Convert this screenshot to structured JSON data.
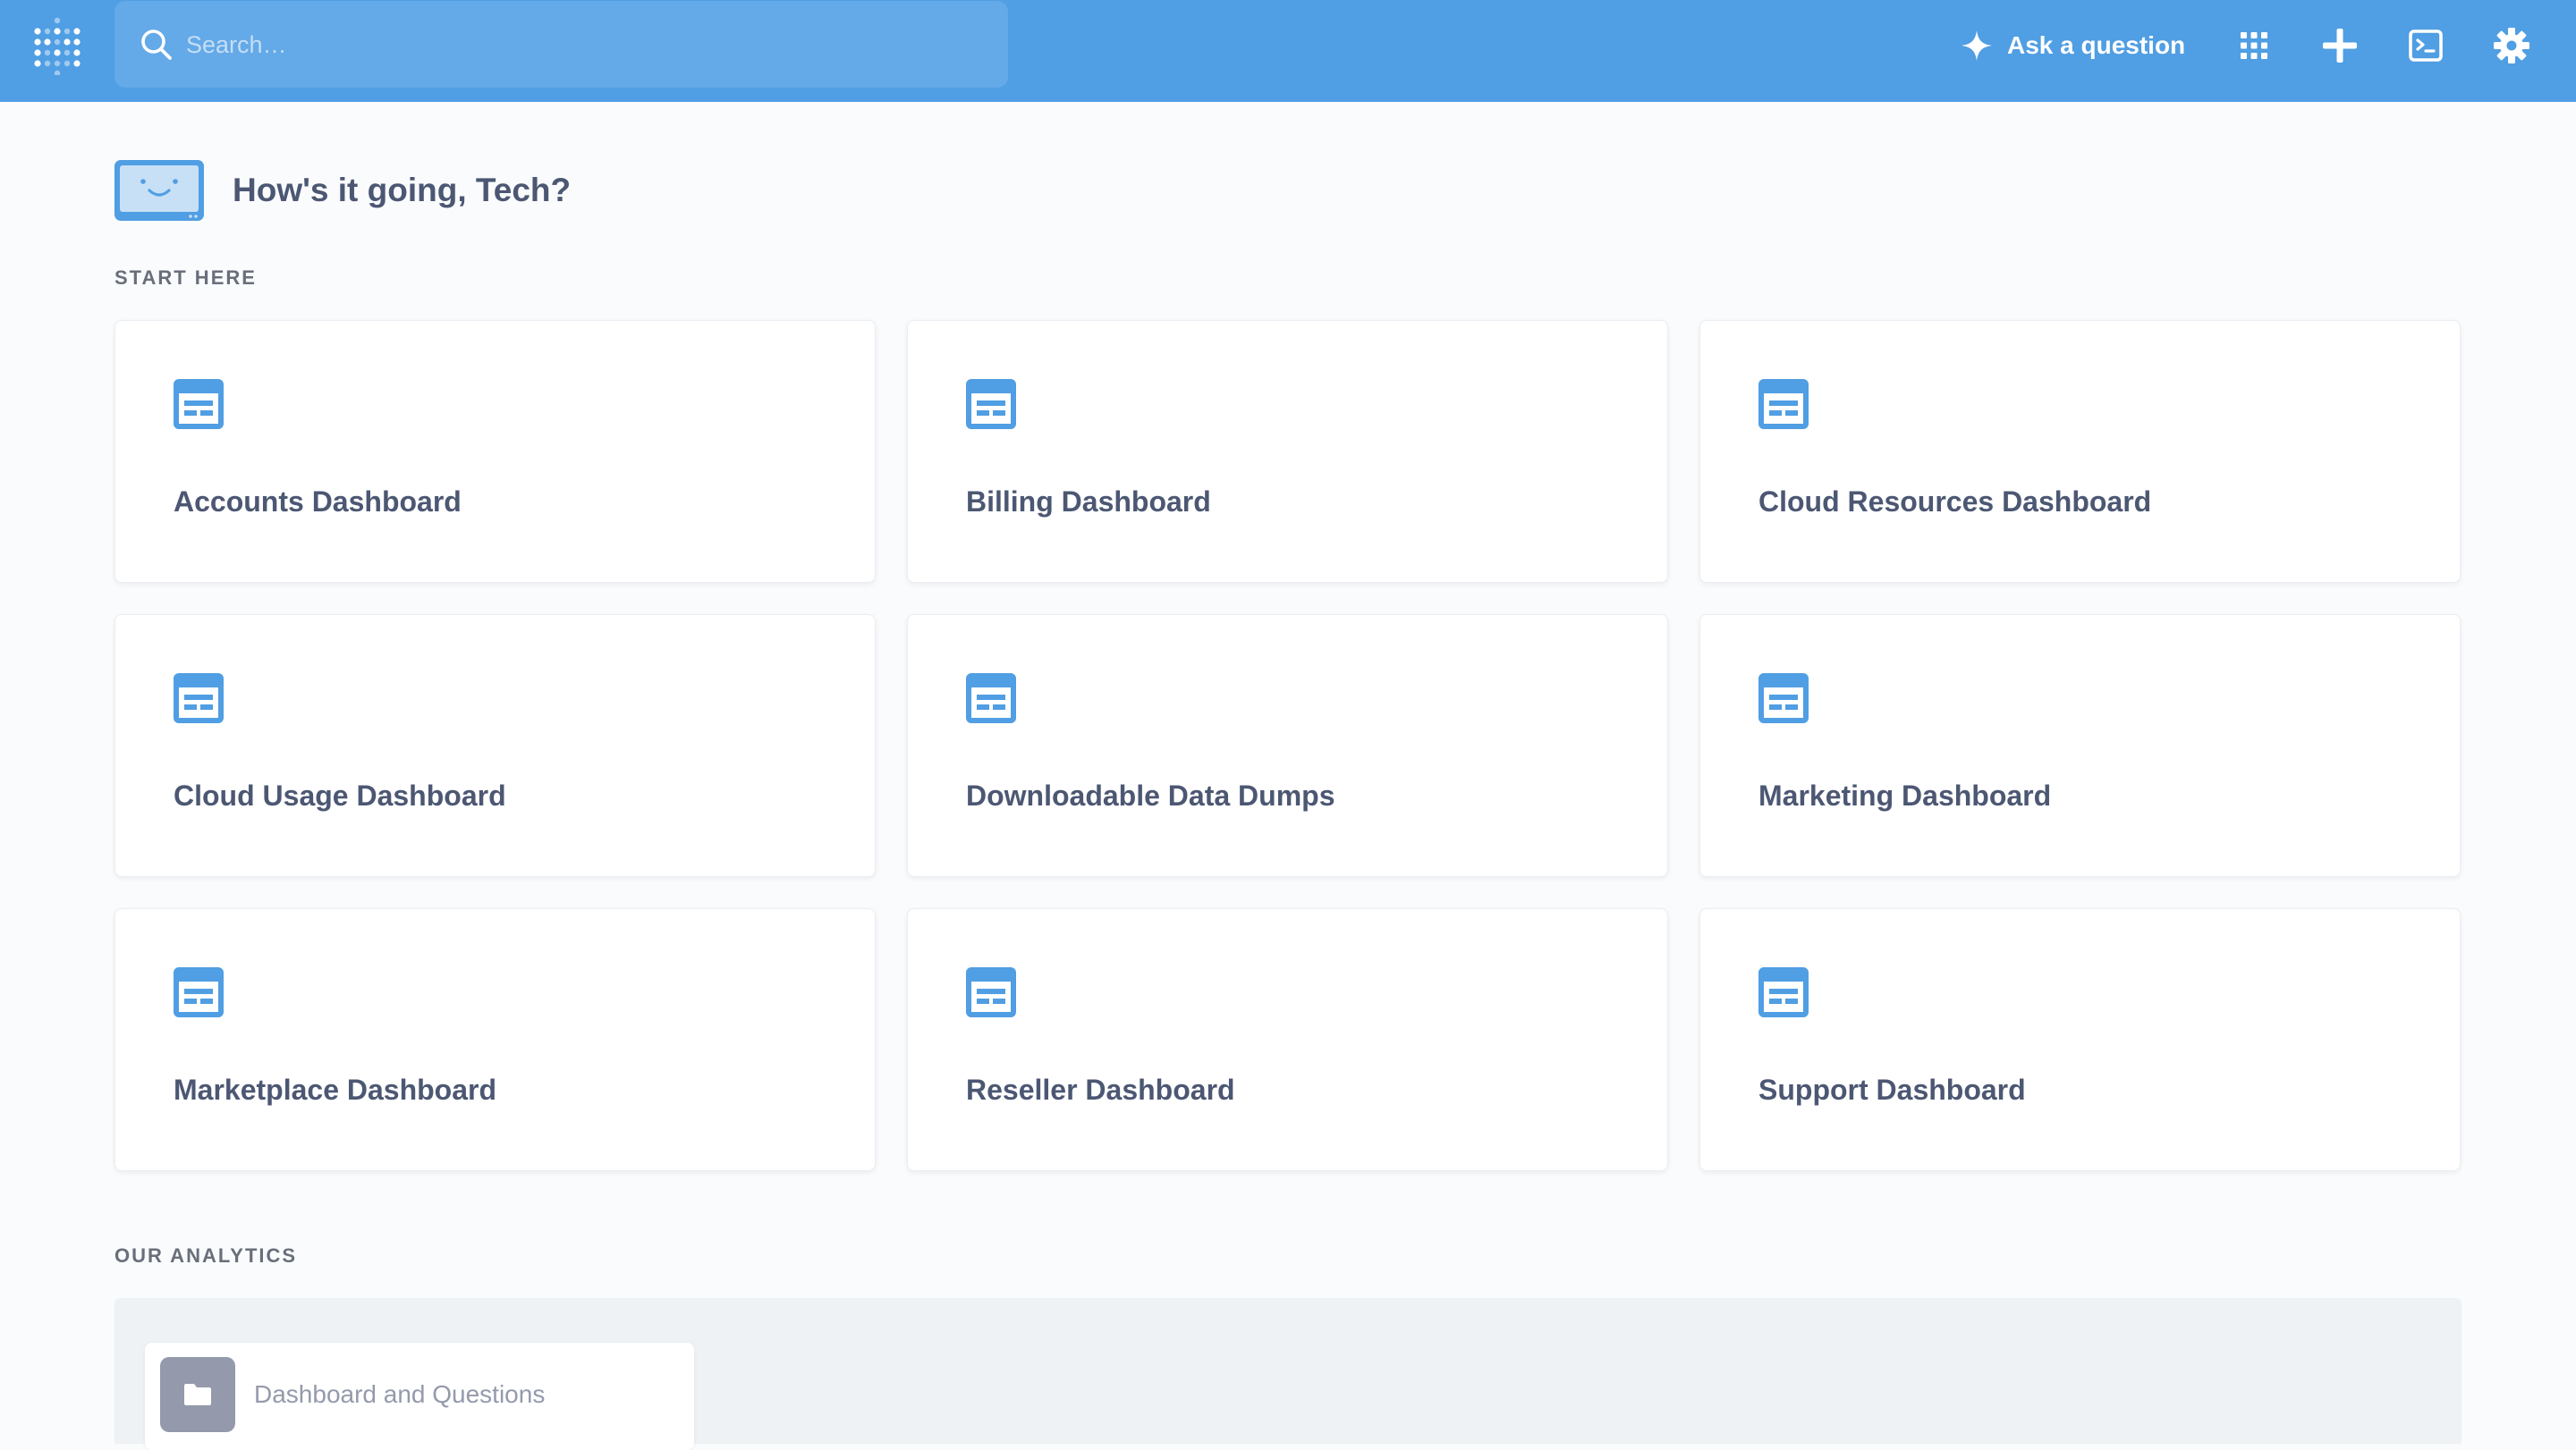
{
  "topbar": {
    "search_placeholder": "Search…",
    "ask_label": "Ask a question",
    "icons": [
      "grid-icon",
      "plus-icon",
      "terminal-icon",
      "gear-icon"
    ]
  },
  "greeting": "How's it going, Tech?",
  "sections": {
    "start_here": "START HERE",
    "our_analytics": "OUR ANALYTICS"
  },
  "dashboards": [
    "Accounts Dashboard",
    "Billing Dashboard",
    "Cloud Resources Dashboard",
    "Cloud Usage Dashboard",
    "Downloadable Data Dumps",
    "Marketing Dashboard",
    "Marketplace Dashboard",
    "Reseller Dashboard",
    "Support Dashboard"
  ],
  "collection": {
    "label": "Dashboard and Questions",
    "icon": "folder-icon"
  },
  "colors": {
    "brand": "#509ee3",
    "text_dark": "#4c5773",
    "text_muted": "#949aab"
  }
}
